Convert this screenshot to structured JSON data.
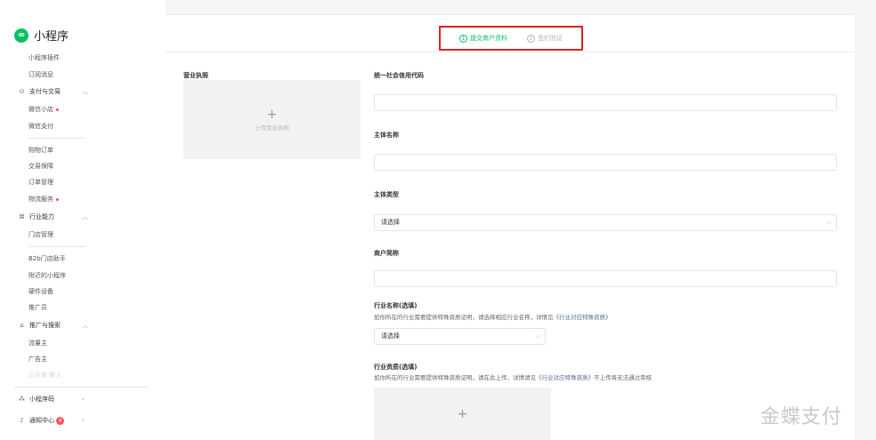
{
  "app": {
    "title": "小程序"
  },
  "sidebar": {
    "top_items": [
      {
        "label": "小程序插件"
      },
      {
        "label": "订阅消息"
      }
    ],
    "group_payment": {
      "label": "支付与交易",
      "icon": "circle-dot-icon"
    },
    "payment_items": [
      {
        "label": "微信小店",
        "dot": true
      },
      {
        "label": "微信支付"
      },
      {
        "label": "购物订单"
      },
      {
        "label": "交易保障"
      },
      {
        "label": "订单管理"
      },
      {
        "label": "物流服务",
        "dot": true
      }
    ],
    "group_industry": {
      "label": "行业能力",
      "icon": "industry-icon"
    },
    "industry_items": [
      {
        "label": "门店管理"
      },
      {
        "label": "B2b门店助手"
      },
      {
        "label": "附近的小程序"
      },
      {
        "label": "硬件设备"
      },
      {
        "label": "推广员"
      }
    ],
    "group_promote": {
      "label": "推广与搜索",
      "icon": "home-icon"
    },
    "promote_items": [
      {
        "label": "流量主"
      },
      {
        "label": "广告主"
      },
      {
        "label": "云开发·推入"
      }
    ],
    "group_code": {
      "label": "小程序码",
      "icon": "qr-icon"
    },
    "group_notify": {
      "label": "通知中心",
      "icon": "bell-icon",
      "badge": "4"
    }
  },
  "steps": [
    {
      "num": "1",
      "label": "提交商户资料",
      "state": "active"
    },
    {
      "num": "2",
      "label": "签约验证",
      "state": "inactive"
    }
  ],
  "form": {
    "license": {
      "label": "营业执照",
      "upload_text": "上传营业执照",
      "plus": "+"
    },
    "credit_code": {
      "label": "统一社会信用代码",
      "value": ""
    },
    "entity_name": {
      "label": "主体名称",
      "value": ""
    },
    "entity_type": {
      "label": "主体类型",
      "value": "请选择"
    },
    "merchant_short": {
      "label": "商户简称",
      "value": ""
    },
    "industry_name": {
      "label": "行业名称(选填)",
      "hint_prefix": "如你所在的行业需要提供特殊资质证明，请选择相应行业名称，详情见",
      "hint_link": "《行业对应特殊资质》",
      "value": "请选择"
    },
    "industry_qual": {
      "label": "行业资质(选填)",
      "hint_prefix": "如你所在的行业需要提供特殊资质证明，请在此上传，详情请见",
      "hint_link": "《行业对应特殊资质》",
      "hint_suffix": "不上传将无法通过审核",
      "plus": "+"
    }
  },
  "watermark": "金蝶支付",
  "colors": {
    "accent": "#07c160",
    "highlight_border": "#e02020",
    "link": "#576b95"
  }
}
